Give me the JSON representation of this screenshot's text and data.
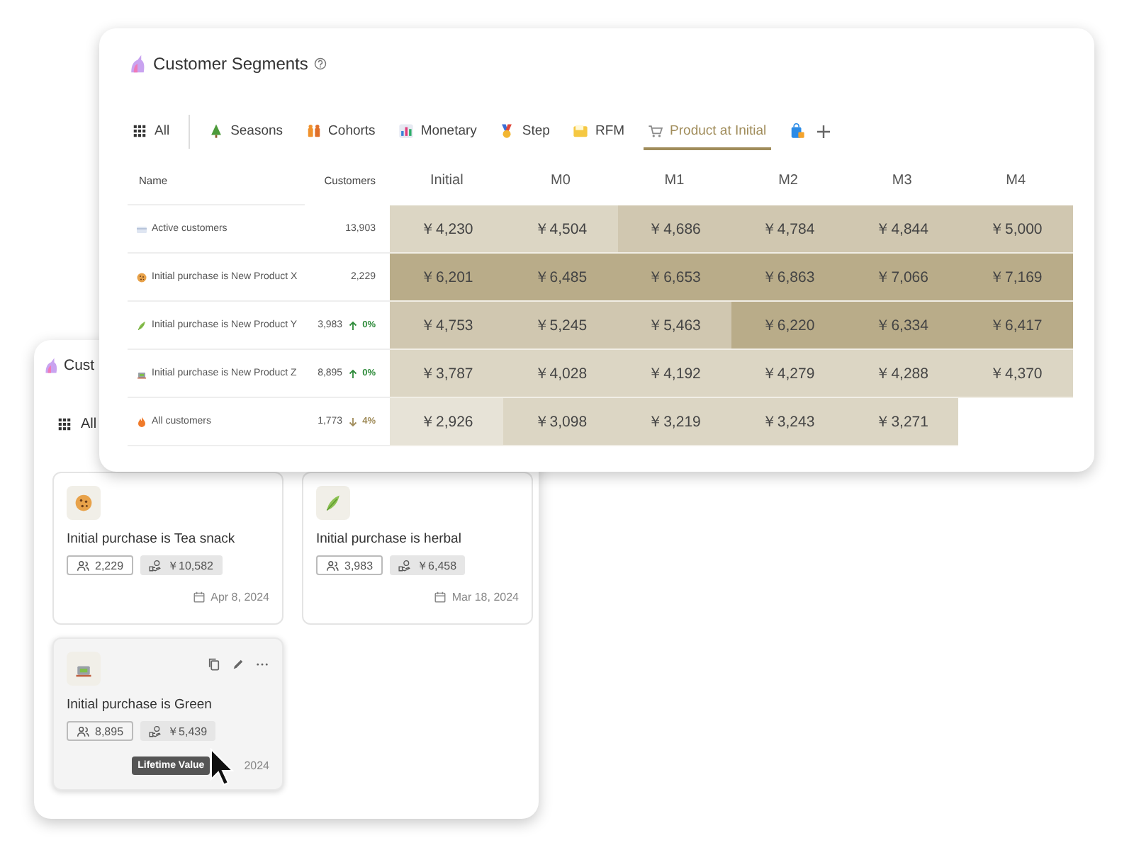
{
  "back_window": {
    "title": "Cust",
    "tab_label": "All",
    "cards": [
      {
        "kind": "cookie",
        "title": "Initial purchase is Tea snack",
        "customers": "2,229",
        "value": "￥10,582",
        "date": "Apr 8, 2024",
        "hovered": false
      },
      {
        "kind": "leaf",
        "title": "Initial purchase is herbal",
        "customers": "3,983",
        "value": "￥6,458",
        "date": "Mar 18, 2024",
        "hovered": false
      },
      {
        "kind": "tea",
        "title": "Initial purchase is Green",
        "customers": "8,895",
        "value": "￥5,439",
        "date": "2024",
        "hovered": true,
        "tooltip": "Lifetime Value"
      }
    ]
  },
  "front_window": {
    "title": "Customer Segments",
    "tabs": [
      {
        "kind": "grid",
        "label": "All",
        "selected": false
      },
      {
        "kind": "tree",
        "label": "Seasons",
        "selected": false
      },
      {
        "kind": "people",
        "label": "Cohorts",
        "selected": false
      },
      {
        "kind": "chart",
        "label": "Monetary",
        "selected": false
      },
      {
        "kind": "medal",
        "label": "Step",
        "selected": false
      },
      {
        "kind": "folder",
        "label": "RFM",
        "selected": false
      },
      {
        "kind": "cart",
        "label": "Product at Initial",
        "selected": true
      },
      {
        "kind": "bag",
        "selected": false
      }
    ],
    "table": {
      "columns": [
        "Name",
        "Customers",
        "Initial",
        "M0",
        "M1",
        "M2",
        "M3",
        "M4"
      ],
      "rows": [
        {
          "kind": "card",
          "cells": [
            {
              "kind": "name",
              "text": "Active customers"
            },
            {
              "kind": "count",
              "text": "13,903"
            },
            {
              "kind": "heat",
              "text": "￥4,230",
              "color": "#dcd6c4"
            },
            {
              "kind": "heat",
              "text": "￥4,504",
              "color": "#dcd6c4"
            },
            {
              "kind": "heat",
              "text": "￥4,686",
              "color": "#d0c7b0"
            },
            {
              "kind": "heat",
              "text": "￥4,784",
              "color": "#d0c7b0"
            },
            {
              "kind": "heat",
              "text": "￥4,844",
              "color": "#d0c7b0"
            },
            {
              "kind": "heat",
              "text": "￥5,000",
              "color": "#d0c7b0"
            }
          ]
        },
        {
          "kind": "cookie",
          "cells": [
            {
              "kind": "name",
              "text": "Initial purchase is New Product X"
            },
            {
              "kind": "count",
              "text": "2,229"
            },
            {
              "kind": "heat",
              "text": "￥6,201",
              "color": "#b9ac89"
            },
            {
              "kind": "heat",
              "text": "￥6,485",
              "color": "#b9ac89"
            },
            {
              "kind": "heat",
              "text": "￥6,653",
              "color": "#b9ac89"
            },
            {
              "kind": "heat",
              "text": "￥6,863",
              "color": "#b9ac89"
            },
            {
              "kind": "heat",
              "text": "￥7,066",
              "color": "#b9ac89"
            },
            {
              "kind": "heat",
              "text": "￥7,169",
              "color": "#b9ac89"
            }
          ]
        },
        {
          "kind": "leaf",
          "cells": [
            {
              "kind": "name",
              "text": "Initial purchase is New Product Y"
            },
            {
              "kind": "count",
              "text": "3,983",
              "change": {
                "kind": "up",
                "text": "0%"
              }
            },
            {
              "kind": "heat",
              "text": "￥4,753",
              "color": "#d0c7b0"
            },
            {
              "kind": "heat",
              "text": "￥5,245",
              "color": "#d0c7b0"
            },
            {
              "kind": "heat",
              "text": "￥5,463",
              "color": "#d0c7b0"
            },
            {
              "kind": "heat",
              "text": "￥6,220",
              "color": "#b9ac89"
            },
            {
              "kind": "heat",
              "text": "￥6,334",
              "color": "#b9ac89"
            },
            {
              "kind": "heat",
              "text": "￥6,417",
              "color": "#b9ac89"
            }
          ]
        },
        {
          "kind": "tea",
          "cells": [
            {
              "kind": "name",
              "text": "Initial purchase is New Product Z"
            },
            {
              "kind": "count",
              "text": "8,895",
              "change": {
                "kind": "up",
                "text": "0%"
              }
            },
            {
              "kind": "heat",
              "text": "￥3,787",
              "color": "#dcd6c4"
            },
            {
              "kind": "heat",
              "text": "￥4,028",
              "color": "#dcd6c4"
            },
            {
              "kind": "heat",
              "text": "￥4,192",
              "color": "#dcd6c4"
            },
            {
              "kind": "heat",
              "text": "￥4,279",
              "color": "#dcd6c4"
            },
            {
              "kind": "heat",
              "text": "￥4,288",
              "color": "#dcd6c4"
            },
            {
              "kind": "heat",
              "text": "￥4,370",
              "color": "#dcd6c4"
            }
          ]
        },
        {
          "kind": "flame",
          "cells": [
            {
              "kind": "name",
              "text": "All customers"
            },
            {
              "kind": "count",
              "text": "1,773",
              "change": {
                "kind": "down",
                "text": "4%"
              }
            },
            {
              "kind": "heat",
              "text": "￥2,926",
              "color": "#e7e3d7"
            },
            {
              "kind": "heat",
              "text": "￥3,098",
              "color": "#dcd6c4"
            },
            {
              "kind": "heat",
              "text": "￥3,219",
              "color": "#dcd6c4"
            },
            {
              "kind": "heat",
              "text": "￥3,243",
              "color": "#dcd6c4"
            },
            {
              "kind": "heat",
              "text": "￥3,271",
              "color": "#dcd6c4"
            }
          ]
        }
      ]
    }
  }
}
